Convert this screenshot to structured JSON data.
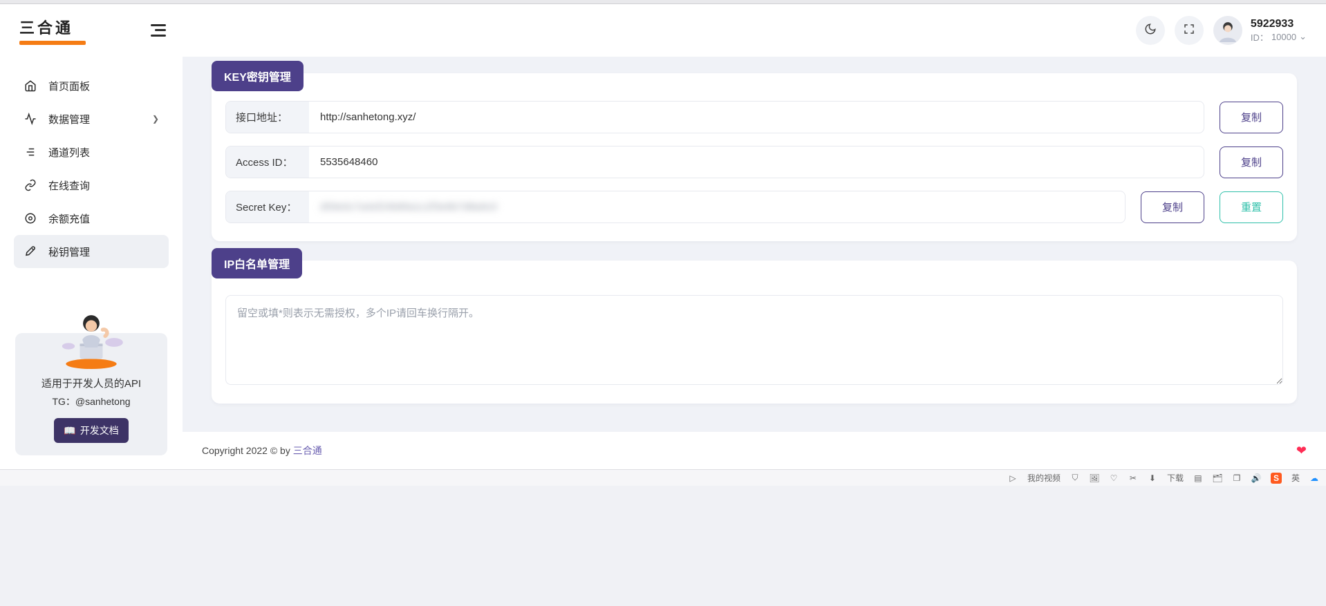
{
  "logo": {
    "text": "三合通"
  },
  "sidebar": {
    "items": [
      {
        "label": "首页面板"
      },
      {
        "label": "数据管理"
      },
      {
        "label": "通道列表"
      },
      {
        "label": "在线查询"
      },
      {
        "label": "余额充值"
      },
      {
        "label": "秘钥管理"
      }
    ],
    "promo": {
      "title": "适用于开发人员的API",
      "subtitle": "TG：@sanhetong",
      "button": "开发文档"
    }
  },
  "topbar": {
    "username": "5922933",
    "user_id_prefix": "ID：",
    "user_id": "10000"
  },
  "sections": {
    "key_mgmt": {
      "title": "KEY密钥管理",
      "rows": {
        "api_url": {
          "label": "接口地址：",
          "value": "http://sanhetong.xyz/"
        },
        "access_id": {
          "label": "Access ID：",
          "value": "5535648460"
        },
        "secret_key": {
          "label": "Secret Key：",
          "value": "d59e0c7a4ef24b89a1c2f3e6b7d8a9c0"
        }
      },
      "actions": {
        "copy": "复制",
        "reset": "重置"
      }
    },
    "ip_whitelist": {
      "title": "IP白名单管理",
      "placeholder": "留空或填*则表示无需授权，多个IP请回车换行隔开。"
    }
  },
  "footer": {
    "prefix": "Copyright 2022 © by ",
    "brand": "三合通"
  },
  "statusbar": {
    "my_video": "我的视频",
    "download": "下载",
    "ime": "英"
  }
}
